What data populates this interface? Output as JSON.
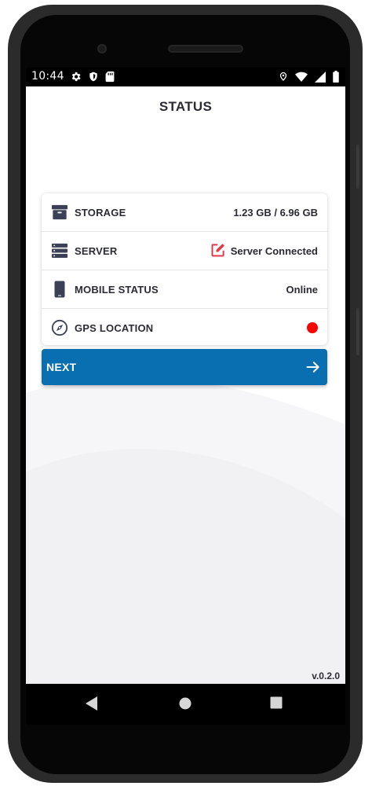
{
  "statusbar": {
    "time": "10:44",
    "icons": [
      "gear-icon",
      "shield-icon",
      "sd-card-icon",
      "location-icon",
      "wifi-icon",
      "signal-icon",
      "battery-icon"
    ]
  },
  "page": {
    "title": "STATUS"
  },
  "status_items": [
    {
      "label": "STORAGE",
      "value": "1.23 GB / 6.96 GB",
      "icon": "archive-icon"
    },
    {
      "label": "SERVER",
      "value": "Server Connected",
      "icon": "server-icon",
      "value_icon": "edit-icon",
      "value_icon_color": "#e23a4b"
    },
    {
      "label": "MOBILE STATUS",
      "value": "Online",
      "icon": "phone-icon"
    },
    {
      "label": "GPS LOCATION",
      "value": "",
      "icon": "compass-icon",
      "indicator_color": "#ff0000"
    }
  ],
  "next_button": {
    "label": "NEXT",
    "icon": "arrow-right-icon"
  },
  "version": "v.0.2.0",
  "navbar": {
    "buttons": [
      "back-icon",
      "home-icon",
      "recents-icon"
    ]
  },
  "colors": {
    "accent": "#0a6fb0",
    "text": "#2b2b33",
    "status_dot": "#ff0000"
  }
}
